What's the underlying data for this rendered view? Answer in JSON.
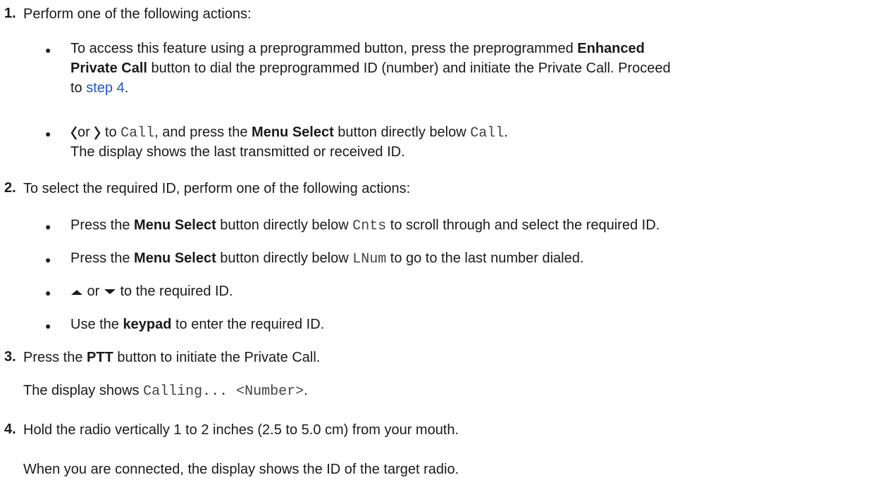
{
  "steps": {
    "s1": {
      "num": "1.",
      "text": "Perform one of the following actions:",
      "b1": {
        "pre": "To access this feature using a preprogrammed button, press the preprogrammed ",
        "bold1": "Enhanced",
        "bold2": "Private Call",
        "mid": " button to dial the preprogrammed ID (number) and initiate the Private Call. Proceed",
        "to": "to ",
        "link": "step 4",
        "end": "."
      },
      "b2": {
        "or": "or",
        "to": " to ",
        "code1": "Call",
        "mid": ", and press the ",
        "bold": "Menu Select",
        "mid2": " button directly below ",
        "code2": "Call",
        "end": ".",
        "line2": "The display shows the last transmitted or received ID."
      }
    },
    "s2": {
      "num": "2.",
      "text": "To select the required ID, perform one of the following actions:",
      "b1": {
        "pre": "Press the ",
        "bold": "Menu Select",
        "mid": " button directly below ",
        "code": "Cnts",
        "end": " to scroll through and select the required ID."
      },
      "b2": {
        "pre": "Press the ",
        "bold": "Menu Select",
        "mid": " button directly below ",
        "code": "LNum",
        "end": " to go to the last number dialed."
      },
      "b3": {
        "or": " or ",
        "end": " to the required ID."
      },
      "b4": {
        "pre": "Use the ",
        "bold": "keypad",
        "end": " to enter the required ID."
      }
    },
    "s3": {
      "num": "3.",
      "pre": "Press the ",
      "bold": "PTT",
      "end": " button to initiate the Private Call.",
      "disp_pre": "The display shows ",
      "disp_code": "Calling... <Number>",
      "disp_end": "."
    },
    "s4": {
      "num": "4.",
      "text": "Hold the radio vertically 1 to 2 inches (2.5 to 5.0 cm) from your mouth.",
      "after": "When you are connected, the display shows the ID of the target radio."
    }
  },
  "bullet": "●",
  "icons": {
    "left": "left-arrow-icon",
    "right": "right-arrow-icon",
    "up": "up-arrow-icon",
    "down": "down-arrow-icon"
  }
}
